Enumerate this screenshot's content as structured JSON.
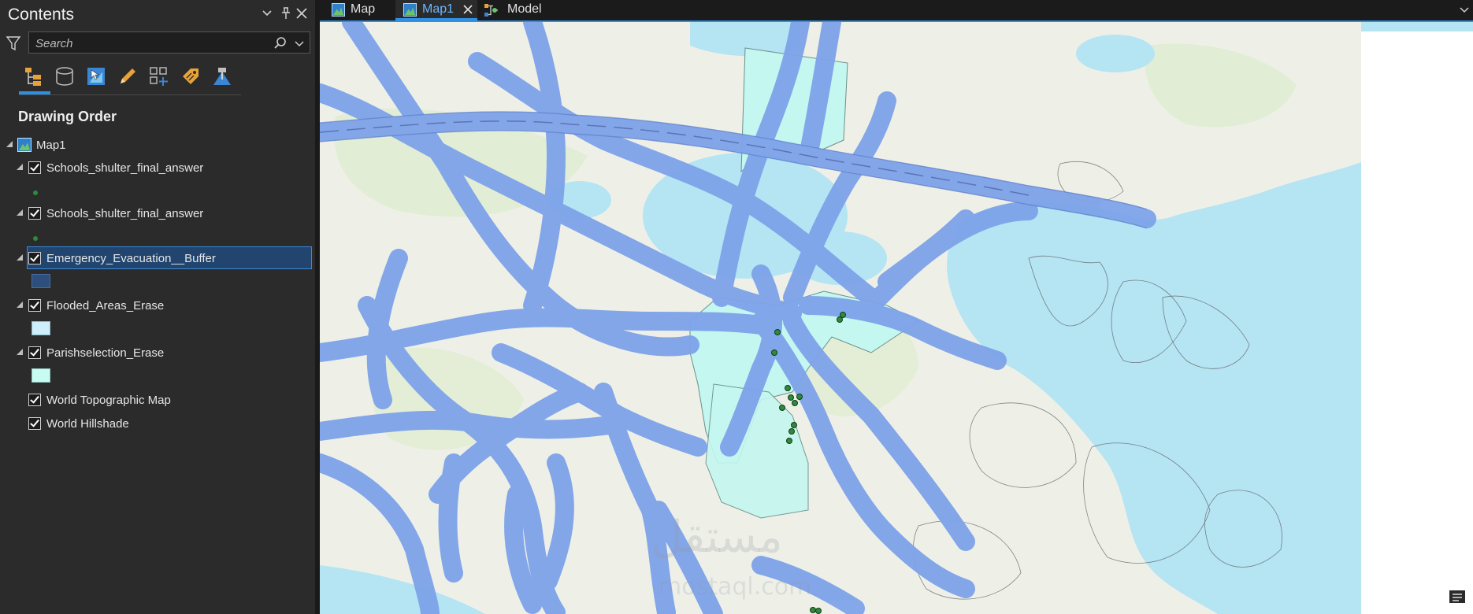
{
  "contents_pane": {
    "title": "Contents",
    "header_buttons": [
      "chevron-down-icon",
      "pin-icon",
      "close-icon"
    ],
    "search": {
      "placeholder": "Search"
    },
    "view_buttons": [
      "list-by-drawing-order-icon",
      "list-by-data-source-icon",
      "list-by-selection-icon",
      "list-by-editing-icon",
      "list-by-snapping-icon",
      "list-by-labeling-icon",
      "list-by-perspective-imagery-icon"
    ],
    "section_title": "Drawing Order",
    "map_node": {
      "label": "Map1"
    },
    "layers": [
      {
        "label": "Schools_shulter_final_answer",
        "checked": true,
        "symbol": "point",
        "symbol_color": "#2e8b3d"
      },
      {
        "label": "Schools_shulter_final_answer",
        "checked": true,
        "symbol": "point",
        "symbol_color": "#2e8b3d"
      },
      {
        "label": "Emergency_Evacuation__Buffer",
        "checked": true,
        "selected": true,
        "symbol": "polygon",
        "symbol_color": "#2d4f7c"
      },
      {
        "label": "Flooded_Areas_Erase",
        "checked": true,
        "symbol": "polygon",
        "symbol_color": "#cdeefa"
      },
      {
        "label": "Parishselection_Erase",
        "checked": true,
        "symbol": "polygon",
        "symbol_color": "#c8fbf3"
      },
      {
        "label": "World Topographic Map",
        "checked": true
      },
      {
        "label": "World Hillshade",
        "checked": true
      }
    ]
  },
  "tabs": [
    {
      "label": "Map",
      "icon": "map-icon",
      "active": false
    },
    {
      "label": "Map1",
      "icon": "map-icon",
      "active": true
    },
    {
      "label": "Model",
      "icon": "model-icon",
      "active": false
    }
  ],
  "map": {
    "colors": {
      "water": "#b5e4f3",
      "land": "#eef0e8",
      "buffer": "#7ea3ea",
      "buffer_outline": "#5877c4",
      "parish": "#c4f7f0",
      "schools": "#2e8b3d",
      "accent": "#2f8fe0"
    },
    "watermark": "مستقل",
    "watermark_line2": "mostaql.com"
  }
}
